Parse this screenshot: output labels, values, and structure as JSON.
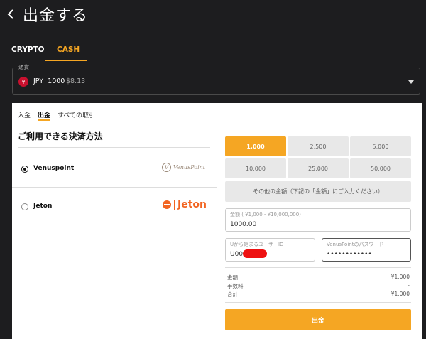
{
  "header": {
    "title": "出金する",
    "back_icon": "chevron-left-icon"
  },
  "top_tabs": [
    {
      "label": "CRYPTO",
      "active": false
    },
    {
      "label": "CASH",
      "active": true
    }
  ],
  "currency": {
    "label": "通貨",
    "code": "JPY",
    "amount": "1000",
    "usd": "$8.13",
    "badge": "¥",
    "badge_color": "#c8102e"
  },
  "sub_tabs": [
    {
      "label": "入金",
      "active": false
    },
    {
      "label": "出金",
      "active": true
    },
    {
      "label": "すべての取引",
      "active": false
    }
  ],
  "methods": {
    "title": "ご利用できる決済方法",
    "items": [
      {
        "name": "Venuspoint",
        "selected": true,
        "logo_text": "VenusPoint",
        "logo_mark": "V"
      },
      {
        "name": "Jeton",
        "selected": false,
        "logo_text": "Jeton"
      }
    ]
  },
  "amounts": {
    "options": [
      "1,000",
      "2,500",
      "5,000",
      "10,000",
      "25,000",
      "50,000"
    ],
    "selected_index": 0,
    "other_label": "その他の金額（下記の「金額」にご入力ください）"
  },
  "form": {
    "amount_label": "金額 ( ¥1,000 - ¥10,000,000)",
    "amount_value": "1000.00",
    "user_id_label": "Uから始まるユーザーID",
    "user_id_value": "U00",
    "password_label": "VenusPointのパスワード",
    "password_value": "••••••••••••"
  },
  "summary": [
    {
      "label": "金額",
      "value": "¥1,000"
    },
    {
      "label": "手数料",
      "value": "-"
    },
    {
      "label": "合計",
      "value": "¥1,000"
    }
  ],
  "submit_label": "出金",
  "colors": {
    "accent": "#f5a623",
    "background": "#1d1d1f",
    "panel": "#ffffff"
  }
}
